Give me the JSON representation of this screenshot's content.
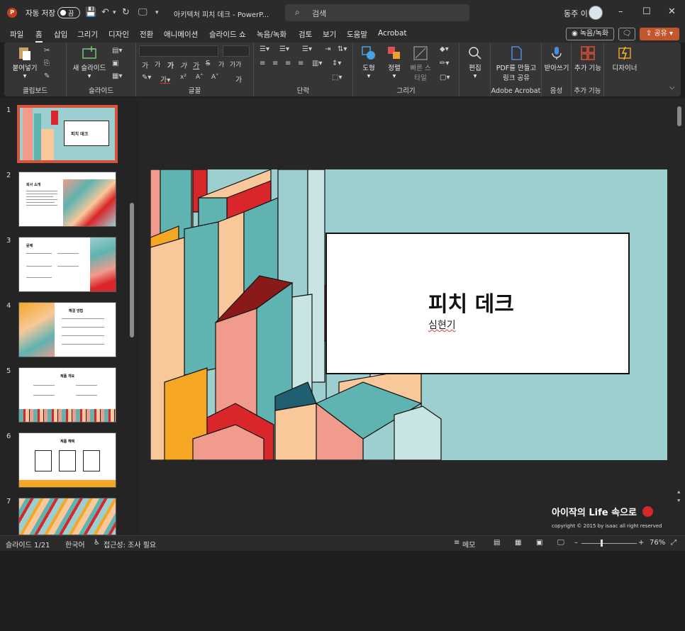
{
  "titlebar": {
    "autosave_label": "자동 저장",
    "toggle_state": "끔",
    "doc_title": "아키텍처 피치 데크  -  PowerP...",
    "search_placeholder": "검색",
    "user_name": "동주 이"
  },
  "tabs": [
    "파일",
    "홈",
    "삽입",
    "그리기",
    "디자인",
    "전환",
    "애니메이션",
    "슬라이드 쇼",
    "녹음/녹화",
    "검토",
    "보기",
    "도움말",
    "Acrobat"
  ],
  "active_tab": "홈",
  "tab_actions": {
    "record": "녹음/녹화",
    "share": "공유"
  },
  "ribbon": {
    "clipboard": {
      "paste": "붙여넣기",
      "label": "클립보드"
    },
    "slides": {
      "new_slide": "새 슬라이드",
      "label": "슬라이드"
    },
    "font": {
      "label": "글꼴",
      "grow": "가",
      "shrink": "가",
      "bold": "가",
      "italic": "가",
      "underline": "가",
      "strike": "S",
      "spacing": "가",
      "case": "가가",
      "clear": "가"
    },
    "paragraph": {
      "label": "단락"
    },
    "drawing": {
      "shapes": "도형",
      "arrange": "정렬",
      "quick_styles": "빠른 스타일",
      "label": "그리기"
    },
    "editing": {
      "edit": "편집"
    },
    "acrobat": {
      "create_pdf": "PDF를 만들고 링크 공유",
      "label": "Adobe Acrobat"
    },
    "voice": {
      "dictate": "받아쓰기",
      "label": "음성"
    },
    "addins": {
      "addins": "추가 기능",
      "label": "추가 기능"
    },
    "designer": {
      "designer": "디자이너"
    }
  },
  "thumbnails": [
    {
      "num": "1",
      "title": "피치 데크"
    },
    {
      "num": "2",
      "title": "회사 소개"
    },
    {
      "num": "3",
      "title": "문제"
    },
    {
      "num": "4",
      "title": "해결 방법"
    },
    {
      "num": "5",
      "title": "제품 개요"
    },
    {
      "num": "6",
      "title": "제품 혜택"
    },
    {
      "num": "7",
      "title": ""
    }
  ],
  "slide": {
    "title": "피치 데크",
    "subtitle": "심현기"
  },
  "watermark": {
    "line1": "아이작의 Life 속으로",
    "line2": "copyright © 2015 by isaac all right reserved"
  },
  "status": {
    "slide_info": "슬라이드 1/21",
    "language": "한국어",
    "accessibility": "접근성: 조사 필요",
    "notes": "메모",
    "zoom": "76%"
  },
  "colors": {
    "accent": "#c4562c",
    "slide_bg": "#9dcfd0",
    "teal": "#5fb3b0",
    "red": "#d9262a",
    "peach": "#f8c89a",
    "pink": "#f09b8c",
    "orange": "#f5a623"
  }
}
